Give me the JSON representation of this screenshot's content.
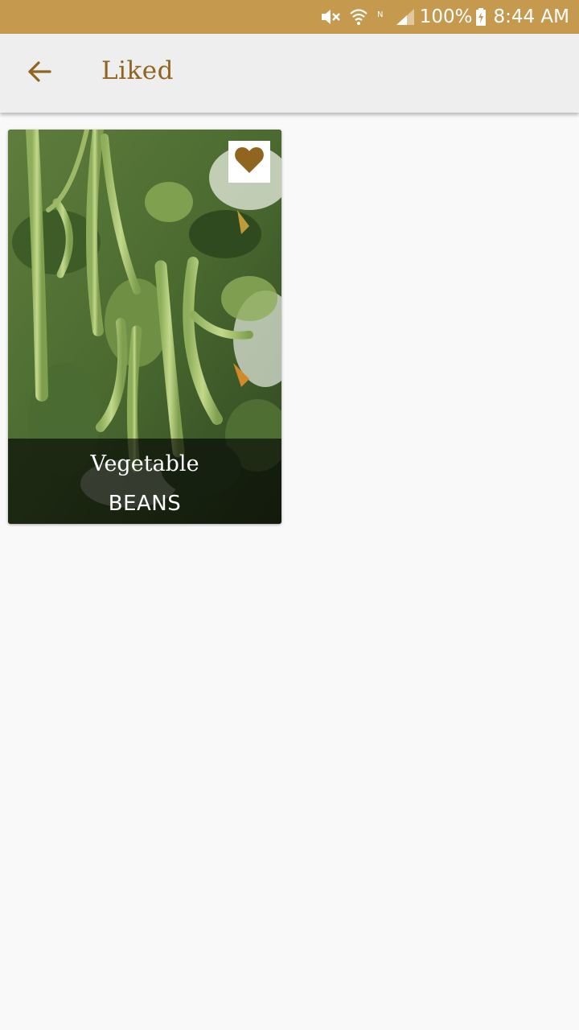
{
  "status_bar": {
    "battery_text": "100%",
    "time": "8:44 AM",
    "icons": [
      "mute-icon",
      "wifi-icon",
      "no-sim-icon",
      "signal-icon",
      "battery-charging-icon"
    ]
  },
  "app_bar": {
    "back_icon": "arrow-left-icon",
    "title": "Liked"
  },
  "liked_items": [
    {
      "category": "Vegetable",
      "name": "BEANS",
      "liked": true,
      "like_icon": "heart-icon"
    }
  ],
  "colors": {
    "status_bar": "#c59a4f",
    "accent": "#8f6520",
    "app_bar": "#eeeeee",
    "background": "#f9f9f9"
  }
}
